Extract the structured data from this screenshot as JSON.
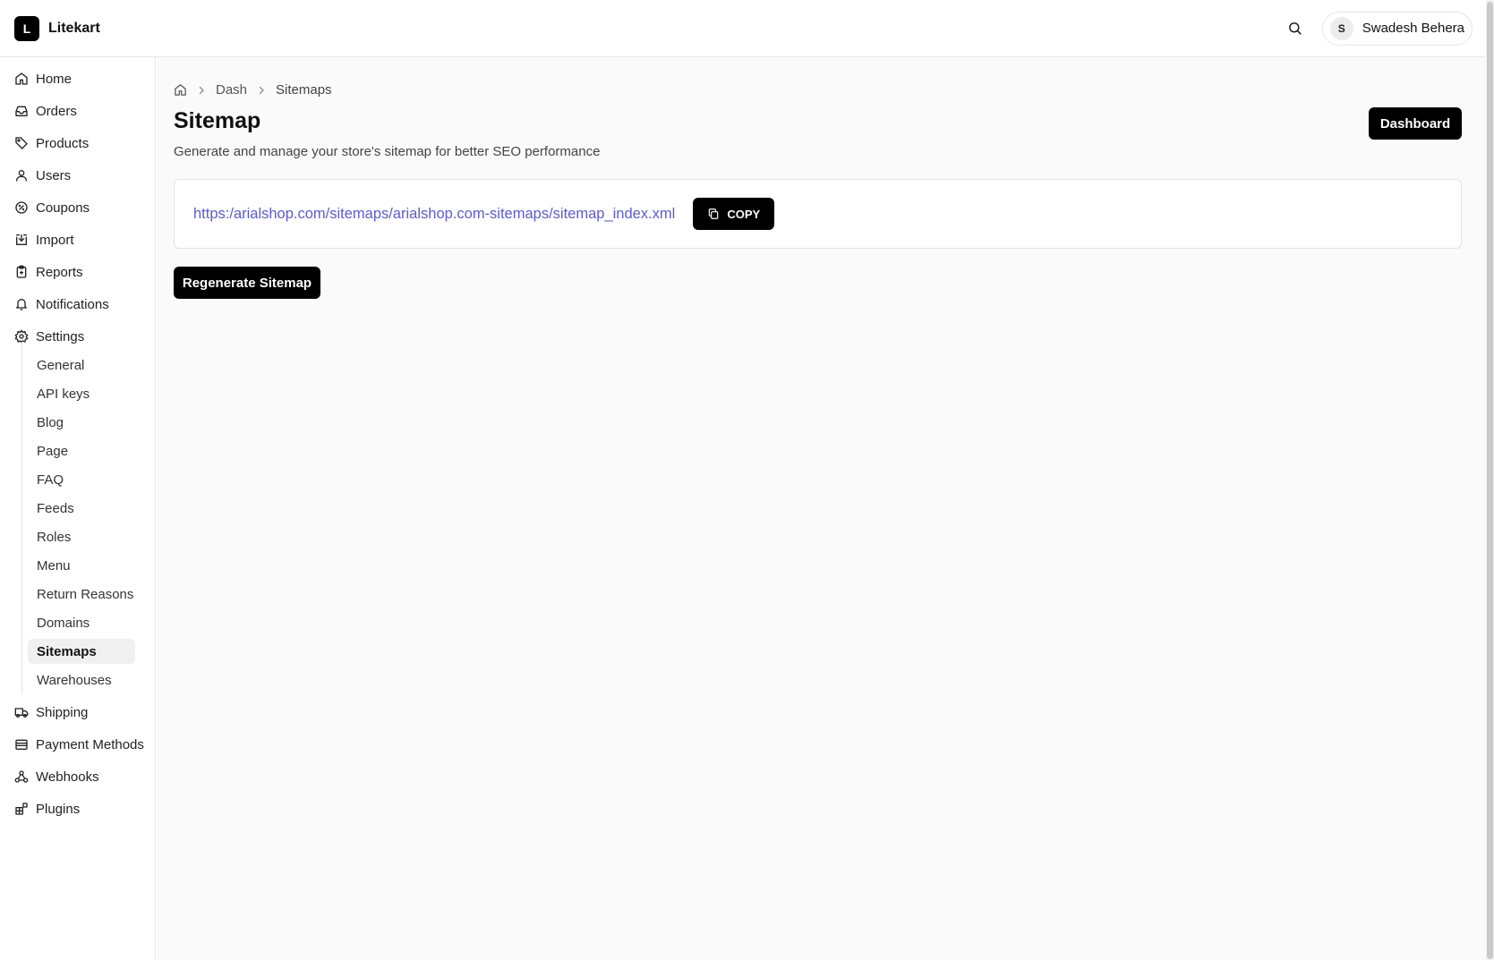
{
  "app": {
    "logo_letter": "L",
    "name": "Litekart"
  },
  "header": {
    "user_initial": "S",
    "user_name": "Swadesh Behera"
  },
  "sidebar": {
    "items": [
      {
        "label": "Home",
        "icon": "home-icon"
      },
      {
        "label": "Orders",
        "icon": "inbox-icon"
      },
      {
        "label": "Products",
        "icon": "tag-icon"
      },
      {
        "label": "Users",
        "icon": "user-icon"
      },
      {
        "label": "Coupons",
        "icon": "badge-percent-icon"
      },
      {
        "label": "Import",
        "icon": "import-icon"
      },
      {
        "label": "Reports",
        "icon": "clipboard-icon"
      },
      {
        "label": "Notifications",
        "icon": "bell-icon"
      },
      {
        "label": "Settings",
        "icon": "gear-icon"
      }
    ],
    "settings_sub": [
      "General",
      "API keys",
      "Blog",
      "Page",
      "FAQ",
      "Feeds",
      "Roles",
      "Menu",
      "Return Reasons",
      "Domains",
      "Sitemaps",
      "Warehouses"
    ],
    "active_sub": "Sitemaps",
    "bottom_items": [
      {
        "label": "Shipping",
        "icon": "truck-icon"
      },
      {
        "label": "Payment Methods",
        "icon": "wallet-icon"
      },
      {
        "label": "Webhooks",
        "icon": "webhook-icon"
      },
      {
        "label": "Plugins",
        "icon": "blocks-icon"
      }
    ]
  },
  "breadcrumb": {
    "items": [
      "Dash",
      "Sitemaps"
    ]
  },
  "page": {
    "title": "Sitemap",
    "description": "Generate and manage your store's sitemap for better SEO performance",
    "dashboard_button": "Dashboard",
    "sitemap_url": "https:/arialshop.com/sitemaps/arialshop.com-sitemaps/sitemap_index.xml",
    "copy_button": "COPY",
    "regenerate_button": "Regenerate Sitemap"
  },
  "colors": {
    "accent_link": "#5b5bd6",
    "primary_button": "#000000",
    "content_bg": "#fafafa"
  }
}
